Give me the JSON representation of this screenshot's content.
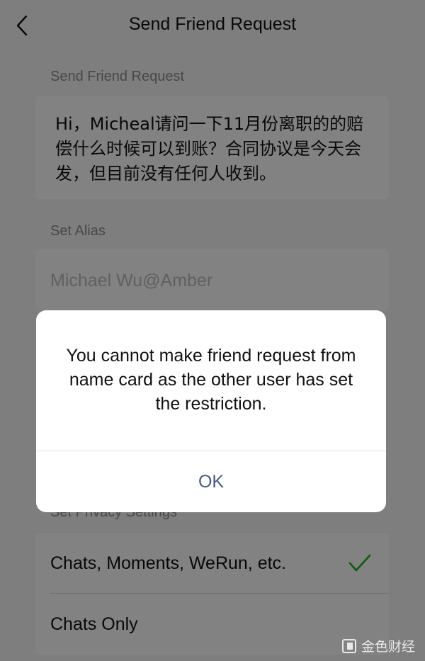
{
  "nav": {
    "title": "Send Friend Request",
    "back_icon": "chevron-left-icon"
  },
  "request": {
    "label": "Send Friend Request",
    "message": "Hi，Micheal请问一下11月份离职的的赔偿什么时候可以到账？合同协议是今天会发，但目前没有任何人收到。"
  },
  "alias": {
    "label": "Set Alias",
    "placeholder": "Michael Wu@Amber"
  },
  "privacy": {
    "label": "Set Privacy Settings",
    "options": [
      {
        "label": "Chats, Moments, WeRun, etc.",
        "selected": true
      },
      {
        "label": "Chats Only",
        "selected": false
      }
    ],
    "check_icon": "checkmark-icon",
    "check_color": "#1aad19"
  },
  "alert": {
    "message": "You cannot make friend request from name card as the other user has set the restriction.",
    "ok_label": "OK",
    "ok_color": "#4a5a85"
  },
  "watermark": {
    "text": "金色财经",
    "icon": "jinse-logo-icon"
  }
}
